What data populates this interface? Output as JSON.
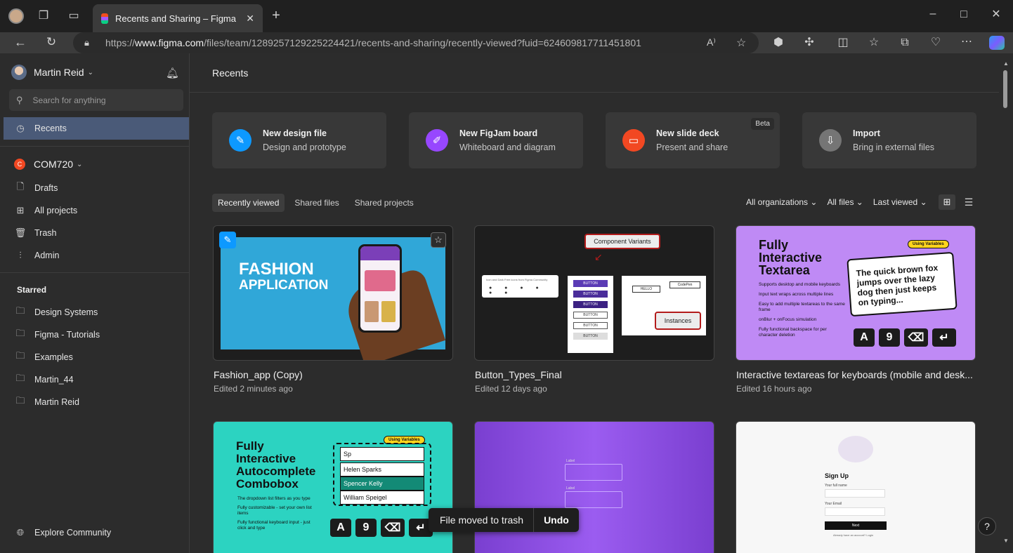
{
  "browser": {
    "tab_title": "Recents and Sharing – Figma",
    "url_prefix": "https://",
    "url_domain": "www.figma.com",
    "url_path": "/files/team/1289257129225224421/recents-and-sharing/recently-viewed?fuid=624609817711451801"
  },
  "sidebar": {
    "user_name": "Martin Reid",
    "search_placeholder": "Search for anything",
    "recents_label": "Recents",
    "team_initial": "C",
    "team_name": "COM720",
    "team_items": [
      {
        "label": "Drafts",
        "icon": "file-icon"
      },
      {
        "label": "All projects",
        "icon": "grid-icon"
      },
      {
        "label": "Trash",
        "icon": "trash-icon"
      },
      {
        "label": "Admin",
        "icon": "sliders-icon"
      }
    ],
    "starred_heading": "Starred",
    "starred_items": [
      "Design Systems",
      "Figma - Tutorials",
      "Examples",
      "Martin_44",
      "Martin Reid"
    ],
    "explore_label": "Explore Community"
  },
  "main": {
    "heading": "Recents",
    "create_cards": [
      {
        "title": "New design file",
        "subtitle": "Design and prototype",
        "color": "#0d99ff",
        "icon": "pen-icon"
      },
      {
        "title": "New FigJam board",
        "subtitle": "Whiteboard and diagram",
        "color": "#9747ff",
        "icon": "marker-icon"
      },
      {
        "title": "New slide deck",
        "subtitle": "Present and share",
        "color": "#f24822",
        "icon": "slides-icon",
        "badge": "Beta"
      },
      {
        "title": "Import",
        "subtitle": "Bring in external files",
        "color": "#757575",
        "icon": "import-icon"
      }
    ],
    "view_tabs": [
      "Recently viewed",
      "Shared files",
      "Shared projects"
    ],
    "filters": [
      "All organizations",
      "All files",
      "Last viewed"
    ],
    "files": [
      {
        "name": "Fashion_app (Copy)",
        "meta": "Edited 2 minutes ago"
      },
      {
        "name": "Button_Types_Final",
        "meta": "Edited 12 days ago"
      },
      {
        "name": "Interactive textareas for keyboards (mobile and desk...",
        "meta": "Edited 16 hours ago"
      }
    ],
    "thumb1": {
      "line1": "FASHION",
      "line2": "APPLICATION"
    },
    "thumb2": {
      "callout1": "Component Variants",
      "callout2": "Instances",
      "button_label": "BUTTON",
      "hello": "HELLO",
      "codepen": "CodePen",
      "caption": "Icon and Dark Free icons from Figma Community"
    },
    "thumb3": {
      "title_l1": "Fully",
      "title_l2": "Interactive",
      "title_l3": "Textarea",
      "tag": "Using Variables",
      "quote": "The quick brown fox jumps over the lazy dog then just keeps on typing...",
      "keys": [
        "A",
        "9",
        "⌫",
        "↵"
      ],
      "bullets": [
        "Supports desktop and mobile keyboards",
        "Input text wraps across multiple lines",
        "Easy to add multiple textareas to the same frame",
        "onBlur + onFocus simulation",
        "Fully functional backspace for per character deletion"
      ]
    },
    "thumb4": {
      "title_l1": "Fully",
      "title_l2": "Interactive",
      "title_l3": "Autocomplete",
      "title_l4": "Combobox",
      "tag": "Using Variables",
      "input": "Sp",
      "options": [
        "Helen Sparks",
        "Spencer Kelly",
        "William Speigel"
      ],
      "keys": [
        "A",
        "9",
        "⌫",
        "↵"
      ],
      "bullets": [
        "The dropdown list filters as you type",
        "Fully customizable - set your own list items",
        "Fully functional keyboard input - just click and type"
      ]
    },
    "thumb5": {
      "label1": "Label",
      "label2": "Label"
    },
    "thumb6": {
      "heading": "Sign Up",
      "field1": "Your full name",
      "field2": "Your Email",
      "button": "Next",
      "footer": "Already have an account? Login"
    }
  },
  "toast": {
    "message": "File moved to trash",
    "action": "Undo"
  },
  "help_label": "?"
}
